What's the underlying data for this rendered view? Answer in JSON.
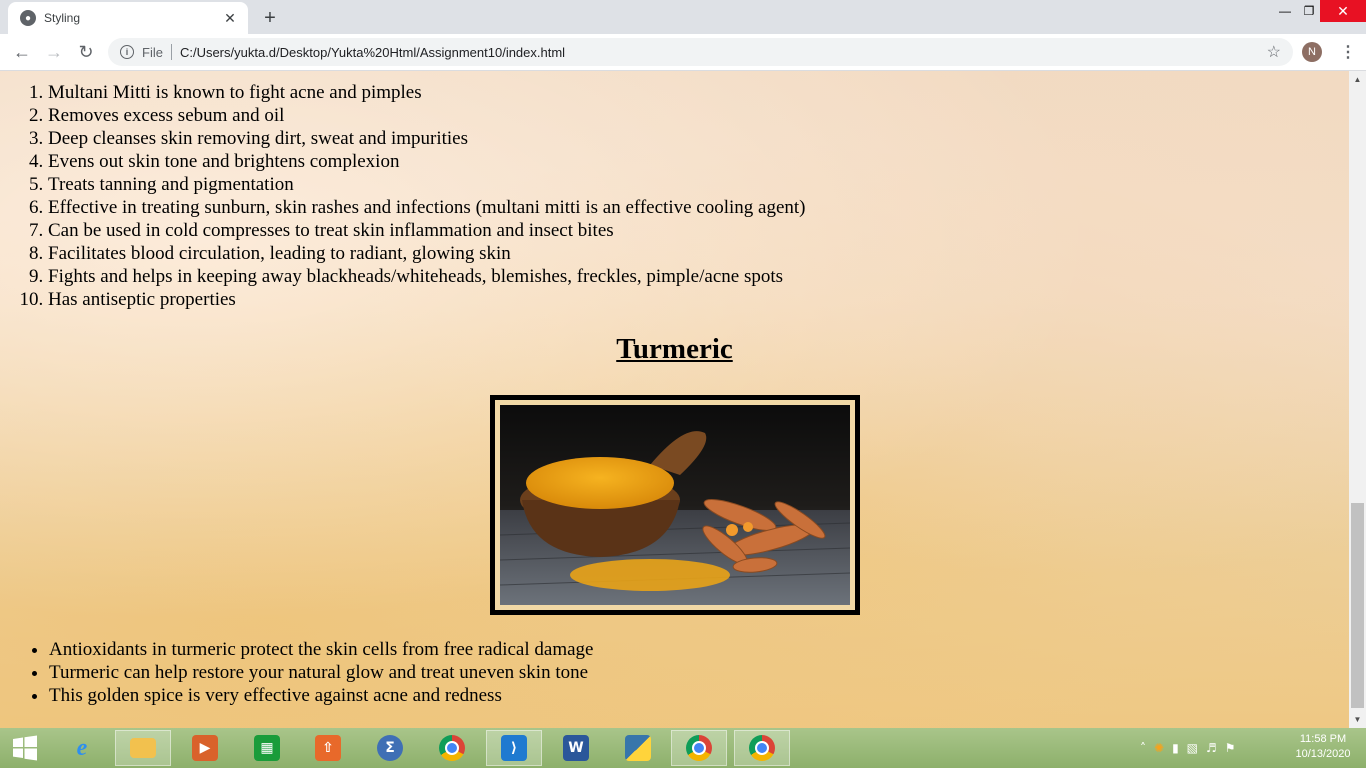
{
  "browser": {
    "tab_title": "Styling",
    "url_scheme": "File",
    "url": "C:/Users/yukta.d/Desktop/Yukta%20Html/Assignment10/index.html",
    "profile_initial": "N"
  },
  "page": {
    "multani_benefits": [
      "Multani Mitti is known to fight acne and pimples",
      "Removes excess sebum and oil",
      "Deep cleanses skin removing dirt, sweat and impurities",
      "Evens out skin tone and brightens complexion",
      "Treats tanning and pigmentation",
      "Effective in treating sunburn, skin rashes and infections (multani mitti is an effective cooling agent)",
      "Can be used in cold compresses to treat skin inflammation and insect bites",
      "Facilitates blood circulation, leading to radiant, glowing skin",
      "Fights and helps in keeping away blackheads/whiteheads, blemishes, freckles, pimple/acne spots",
      "Has antiseptic properties"
    ],
    "turmeric_heading": "Turmeric",
    "turmeric_image_alt": "turmeric powder in wooden bowl with roots",
    "turmeric_benefits": [
      "Antioxidants in turmeric protect the skin cells from free radical damage",
      "Turmeric can help restore your natural glow and treat uneven skin tone",
      "This golden spice is very effective against acne and redness"
    ]
  },
  "taskbar": {
    "apps": [
      "start",
      "internet-explorer",
      "file-explorer",
      "media-player",
      "store",
      "office-upload",
      "math-input",
      "chrome",
      "vs-code",
      "word",
      "python",
      "chrome-n",
      "chrome-y"
    ],
    "clock_time": "11:58 PM",
    "clock_date": "10/13/2020"
  },
  "colors": {
    "close_button": "#e81123",
    "taskbar": "#8db06b",
    "frame_border": "#000000",
    "frame_mat": "#f2d9a6"
  }
}
